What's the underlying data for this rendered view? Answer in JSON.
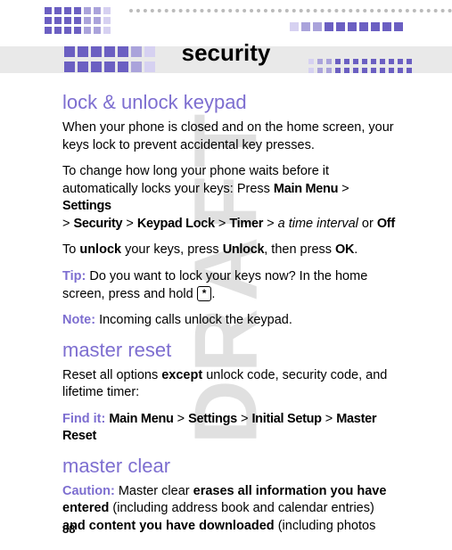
{
  "watermark": "DRAFT",
  "title": "security",
  "page_number": "88",
  "sections": {
    "lock": {
      "heading": "lock & unlock keypad",
      "p1": "When your phone is closed and on the home screen, your keys lock to prevent accidental key presses.",
      "p2_a": "To change how long your phone waits before it automatically locks your keys: Press ",
      "menu_main": "Main Menu",
      "gt": ">",
      "menu_settings": "Settings",
      "menu_security": "Security",
      "menu_keypadlock": "Keypad Lock",
      "menu_timer": "Timer",
      "interval": "a time interval",
      "or": " or ",
      "off": "Off",
      "p3_a": "To ",
      "p3_b": "unlock",
      "p3_c": " your keys, press ",
      "unlock": "Unlock",
      "p3_d": ", then press ",
      "ok": "OK",
      "p3_e": ".",
      "tip_label": "Tip:",
      "tip_text": " Do you want to lock your keys now? In the home screen, press and hold ",
      "tip_key": "*",
      "tip_end": ".",
      "note_label": "Note:",
      "note_text": " Incoming calls unlock the keypad."
    },
    "reset": {
      "heading": "master reset",
      "p1_a": "Reset all options ",
      "p1_b": "except",
      "p1_c": " unlock code, security code, and lifetime timer:",
      "findit_label": "Find it:",
      "menu_main": "Main Menu",
      "gt": ">",
      "menu_settings": "Settings",
      "menu_initial": "Initial Setup",
      "menu_masterreset": "Master Reset"
    },
    "clear": {
      "heading": "master clear",
      "caution_label": "Caution:",
      "p1_a": " Master clear ",
      "p1_b": "erases all information you have entered",
      "p1_c": " (including address book and calendar entries) ",
      "p1_d": "and content you have downloaded",
      "p1_e": " (including photos"
    }
  }
}
